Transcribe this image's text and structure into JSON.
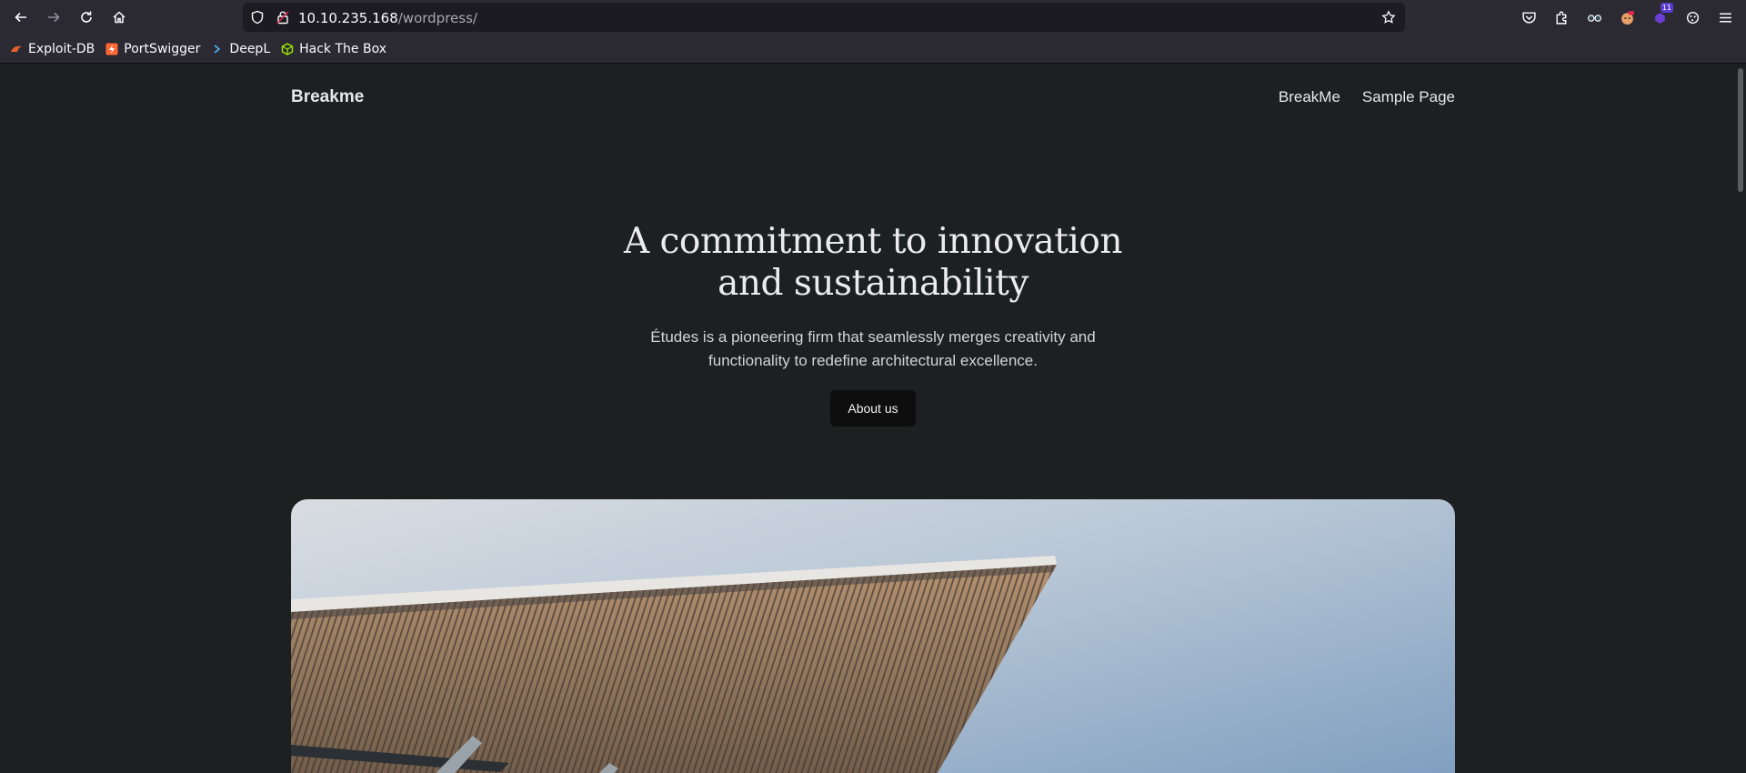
{
  "browser": {
    "url_host": "10.10.235.168",
    "url_path": "/wordpress/",
    "icons": {
      "back": "arrow-left-icon",
      "forward": "arrow-right-icon",
      "reload": "reload-icon",
      "home": "home-icon",
      "shield": "tracking-shield-icon",
      "insecure_lock": "insecure-lock-icon",
      "bookmark": "star-icon"
    },
    "extensions": [
      {
        "name": "pocket-icon",
        "badge": ""
      },
      {
        "name": "extensions-puzzle-icon",
        "badge": ""
      },
      {
        "name": "glasses-extension-icon",
        "badge": ""
      },
      {
        "name": "cookie-face-extension-icon",
        "badge": ""
      },
      {
        "name": "purple-extension-icon",
        "badge": "11"
      },
      {
        "name": "settings-extension-icon",
        "badge": ""
      },
      {
        "name": "menu-hamburger-icon",
        "badge": ""
      }
    ],
    "bookmarks": [
      {
        "label": "Exploit-DB",
        "icon": "exploit-db-icon",
        "color": "#e8612c"
      },
      {
        "label": "PortSwigger",
        "icon": "portswigger-icon",
        "color": "#ff6633"
      },
      {
        "label": "DeepL",
        "icon": "deepl-icon",
        "color": "#0f2b46"
      },
      {
        "label": "Hack The Box",
        "icon": "hackthebox-icon",
        "color": "#9fef00"
      }
    ]
  },
  "site": {
    "title": "Breakme",
    "nav": [
      "BreakMe",
      "Sample Page"
    ],
    "hero": {
      "heading_line1": "A commitment to innovation",
      "heading_line2": "and sustainability",
      "text_line1": "Études is a pioneering firm that seamlessly merges creativity and",
      "text_line2": "functionality to redefine architectural excellence.",
      "button_label": "About us"
    },
    "image": "architecture-building-photo"
  },
  "colors": {
    "page_background": "#1c2021",
    "browser_chrome": "#2b2a33",
    "button_background": "#0e0e0e"
  }
}
